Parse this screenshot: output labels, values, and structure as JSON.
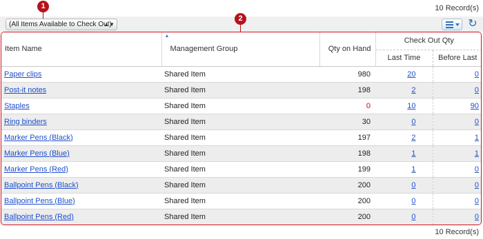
{
  "records_label": "10 Record(s)",
  "filter": {
    "selected": "(All Items Available to Check Out)"
  },
  "markers": [
    "1",
    "2"
  ],
  "columns": {
    "item_name": "Item Name",
    "management_group": "Management Group",
    "qty_on_hand": "Qty on Hand",
    "check_out_qty": "Check Out Qty",
    "last_time": "Last Time",
    "before_last": "Before Last"
  },
  "rows": [
    {
      "name": "Paper clips",
      "group": "Shared Item",
      "qty": "980",
      "last": "20",
      "before": "0"
    },
    {
      "name": "Post-it notes",
      "group": "Shared Item",
      "qty": "198",
      "last": "2",
      "before": "0"
    },
    {
      "name": "Staples",
      "group": "Shared Item",
      "qty": "0",
      "last": "10",
      "before": "90"
    },
    {
      "name": "Ring binders",
      "group": "Shared Item",
      "qty": "30",
      "last": "0",
      "before": "0"
    },
    {
      "name": "Marker Pens (Black)",
      "group": "Shared Item",
      "qty": "197",
      "last": "2",
      "before": "1"
    },
    {
      "name": "Marker Pens (Blue)",
      "group": "Shared Item",
      "qty": "198",
      "last": "1",
      "before": "1"
    },
    {
      "name": "Marker Pens (Red)",
      "group": "Shared Item",
      "qty": "199",
      "last": "1",
      "before": "0"
    },
    {
      "name": "Ballpoint Pens (Black)",
      "group": "Shared Item",
      "qty": "200",
      "last": "0",
      "before": "0"
    },
    {
      "name": "Ballpoint Pens (Blue)",
      "group": "Shared Item",
      "qty": "200",
      "last": "0",
      "before": "0"
    },
    {
      "name": "Ballpoint Pens (Red)",
      "group": "Shared Item",
      "qty": "200",
      "last": "0",
      "before": "0"
    }
  ],
  "icons": {
    "menu": "list-menu-icon",
    "refresh": "refresh-icon",
    "sort": "sort-ascending-icon"
  },
  "colors": {
    "marker": "#b5121b",
    "highlight_border": "#d0121b",
    "link": "#1d4fcc",
    "zero_stock": "#dd0000",
    "accent": "#2d6fb7"
  }
}
